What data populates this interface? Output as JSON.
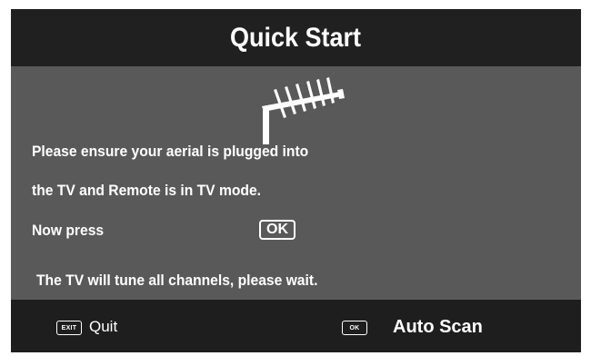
{
  "header": {
    "title": "Quick Start"
  },
  "instructions": {
    "line1": "Please ensure your aerial is plugged into",
    "line2": "the TV and Remote is in TV mode.",
    "now_press": "Now press",
    "ok_key": "OK",
    "tune_message": "The TV will tune all channels, please wait."
  },
  "footer": {
    "quit_key": "EXIT",
    "quit_label": "Quit",
    "scan_key": "OK",
    "scan_label": "Auto Scan"
  },
  "icons": {
    "aerial": "antenna-icon"
  },
  "colors": {
    "panel": "#595959",
    "title_bar": "#202020",
    "footer_bar": "#1e1e1e",
    "text": "#ffffff"
  }
}
